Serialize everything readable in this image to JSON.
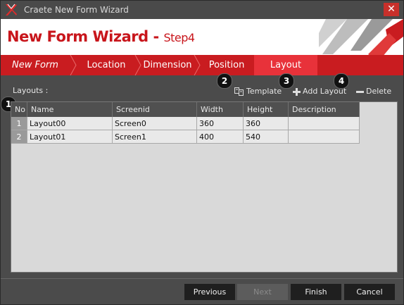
{
  "window": {
    "title": "Craete New Form Wizard",
    "close_glyph": "✕"
  },
  "header": {
    "title": "New Form Wizard - ",
    "step": "Step4"
  },
  "steps": [
    "New Form",
    "Location",
    "Dimension",
    "Position",
    "Layout"
  ],
  "content": {
    "layouts_label": "Layouts :",
    "toolbar": {
      "template": "Template",
      "add": "Add Layout",
      "delete": "Delete"
    },
    "badges": [
      "1",
      "2",
      "3",
      "4"
    ],
    "columns": [
      "No",
      "Name",
      "Screenid",
      "Width",
      "Height",
      "Description"
    ],
    "rows": [
      {
        "no": "1",
        "name": "Layout00",
        "screenid": "Screen0",
        "width": "360",
        "height": "360",
        "description": ""
      },
      {
        "no": "2",
        "name": "Layout01",
        "screenid": "Screen1",
        "width": "400",
        "height": "540",
        "description": ""
      }
    ]
  },
  "footer": {
    "previous": "Previous",
    "next": "Next",
    "finish": "Finish",
    "cancel": "Cancel"
  },
  "colors": {
    "brand_red": "#c8151b",
    "active_step": "#e8323a"
  }
}
